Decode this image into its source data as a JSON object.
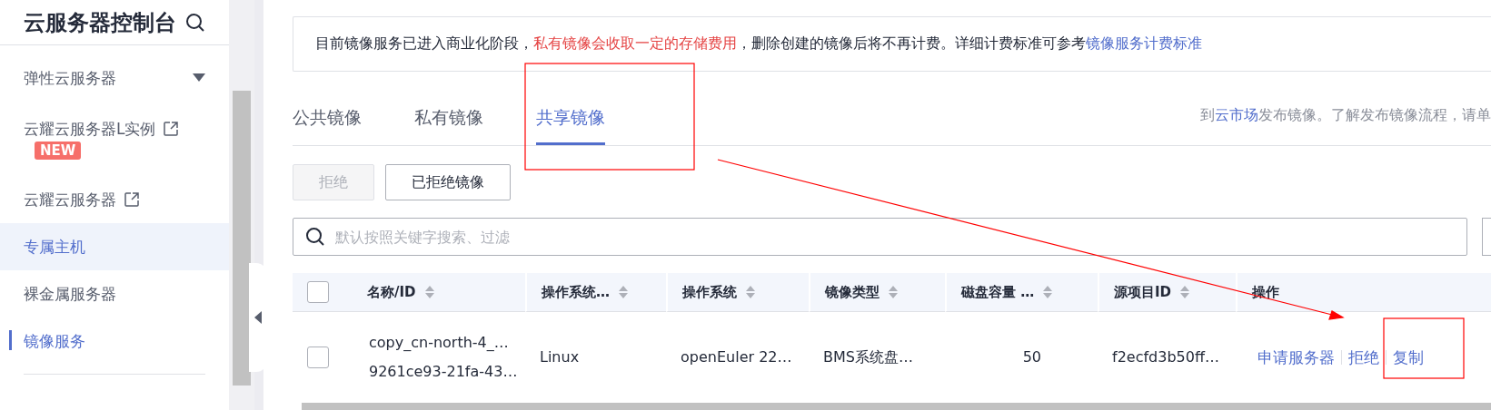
{
  "sidebar": {
    "title": "云服务器控制台",
    "items": [
      {
        "label": "弹性云服务器",
        "selected": false,
        "highlighted": false,
        "dropdown": true,
        "external": false
      },
      {
        "label": "云耀云服务器L实例",
        "selected": false,
        "highlighted": false,
        "dropdown": false,
        "external": true,
        "badge": "NEW"
      },
      {
        "label": "云耀云服务器",
        "selected": false,
        "highlighted": false,
        "dropdown": false,
        "external": true
      },
      {
        "label": "专属主机",
        "selected": false,
        "highlighted": true,
        "dropdown": false,
        "external": false
      },
      {
        "label": "裸金属服务器",
        "selected": false,
        "highlighted": false,
        "dropdown": false,
        "external": false
      },
      {
        "label": "镜像服务",
        "selected": true,
        "highlighted": false,
        "dropdown": false,
        "external": false
      }
    ]
  },
  "notice": [
    {
      "kind": "plain",
      "text": "目前镜像服务已进入商业化阶段，"
    },
    {
      "kind": "warning",
      "text": "私有镜像会收取一定的存储费用"
    },
    {
      "kind": "plain",
      "text": "，删除创建的镜像后将不再计费。详细计费标准可参考"
    },
    {
      "kind": "link",
      "text": "镜像服务计费标准"
    }
  ],
  "tabs": [
    {
      "label": "公共镜像",
      "selected": false
    },
    {
      "label": "私有镜像",
      "selected": false
    },
    {
      "label": "共享镜像",
      "selected": true
    }
  ],
  "tab_hint": [
    {
      "kind": "plain",
      "text": "到"
    },
    {
      "kind": "link",
      "text": "云市场"
    },
    {
      "kind": "plain",
      "text": "发布镜像。了解发布镜像流程，请单"
    }
  ],
  "buttons": [
    {
      "label": "拒绝",
      "disabled": true
    },
    {
      "label": "已拒绝镜像",
      "disabled": false
    }
  ],
  "search": {
    "placeholder": "默认按照关键字搜索、过滤"
  },
  "table": {
    "all_checked": false,
    "columns": [
      {
        "label": "名称/ID",
        "sortable": true
      },
      {
        "label": "操作系统…",
        "sortable": true
      },
      {
        "label": "操作系统",
        "sortable": true
      },
      {
        "label": "镜像类型",
        "sortable": true
      },
      {
        "label": "磁盘容量 …",
        "sortable": true
      },
      {
        "label": "源项目ID",
        "sortable": true
      },
      {
        "label": "操作",
        "sortable": false
      }
    ],
    "rows": [
      {
        "checked": false,
        "cells": [
          {
            "kind": "text",
            "lines": [
              "copy_cn-north-4_…",
              "9261ce93-21fa-43…"
            ]
          },
          {
            "kind": "text",
            "lines": [
              "Linux"
            ]
          },
          {
            "kind": "text",
            "lines": [
              "openEuler 22…"
            ]
          },
          {
            "kind": "text",
            "lines": [
              "BMS系统盘…"
            ]
          },
          {
            "kind": "number",
            "lines": [
              "50"
            ]
          },
          {
            "kind": "text",
            "lines": [
              "f2ecfd3b50ff…"
            ]
          },
          {
            "kind": "links",
            "lines": [
              "申请服务器",
              "拒绝",
              "复制"
            ]
          }
        ]
      }
    ]
  }
}
